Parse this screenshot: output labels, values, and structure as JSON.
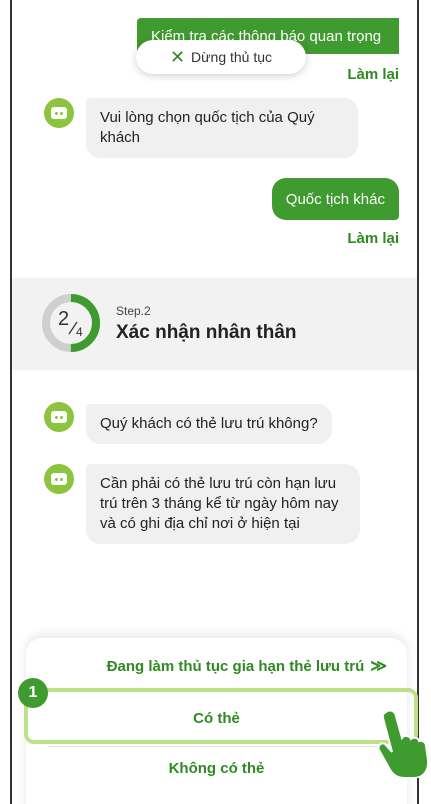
{
  "chat": {
    "msg_user_1": "Kiểm tra các thông báo quan trọng",
    "stop_label": "Dừng thủ tục",
    "redo_1": "Làm lại",
    "bot_1": "Vui lòng chọn quốc tịch của Quý khách",
    "msg_user_2": "Quốc tịch khác",
    "redo_2": "Làm lại",
    "bot_2": "Quý khách có thẻ lưu trú không?",
    "bot_3": "Cần phải có thẻ lưu trú còn hạn lưu trú trên 3 tháng kể từ ngày hôm nay và có ghi địa chỉ nơi ở hiện tại"
  },
  "step": {
    "current": "2",
    "total": "4",
    "label": "Step.2",
    "title": "Xác nhận nhân thân",
    "progress": 0.5
  },
  "sheet": {
    "processing": "Đang làm thủ tục gia hạn thẻ lưu trú",
    "option_yes": "Có thẻ",
    "option_no": "Không có thẻ"
  },
  "annotation": {
    "badge": "1"
  },
  "colors": {
    "accent": "#3f9a2f",
    "highlight": "#bfe08a",
    "bot": "#8cc43d"
  }
}
